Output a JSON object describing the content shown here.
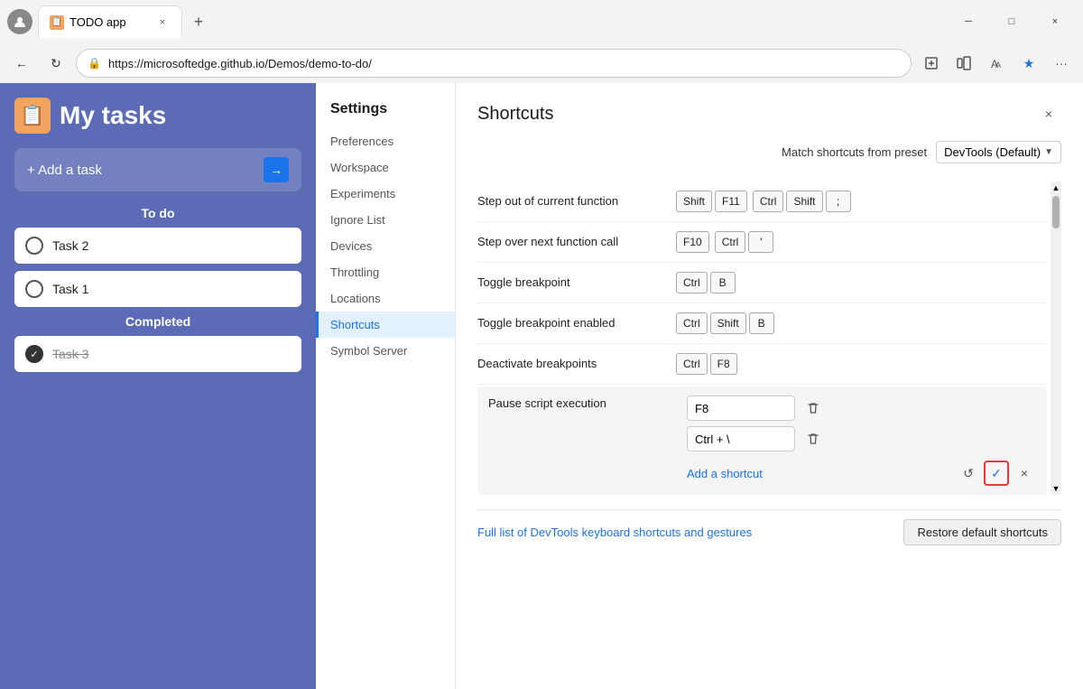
{
  "browser": {
    "tab_title": "TODO app",
    "url": "https://microsoftedge.github.io/Demos/demo-to-do/",
    "favicon": "📋",
    "nav": {
      "back": "←",
      "refresh": "↻",
      "forward": "→"
    },
    "window_controls": {
      "minimize": "─",
      "maximize": "□",
      "close": "×"
    }
  },
  "todo": {
    "title": "My tasks",
    "icon": "📋",
    "add_placeholder": "+ Add a task",
    "arrow": "→",
    "sections": {
      "todo_label": "To do",
      "completed_label": "Completed"
    },
    "tasks": [
      {
        "id": "task2",
        "text": "Task 2",
        "completed": false
      },
      {
        "id": "task1",
        "text": "Task 1",
        "completed": false
      }
    ],
    "completed_tasks": [
      {
        "id": "task3",
        "text": "Task 3",
        "completed": true
      }
    ]
  },
  "settings": {
    "title": "Settings",
    "nav_items": [
      {
        "id": "preferences",
        "label": "Preferences",
        "active": false
      },
      {
        "id": "workspace",
        "label": "Workspace",
        "active": false
      },
      {
        "id": "experiments",
        "label": "Experiments",
        "active": false
      },
      {
        "id": "ignore-list",
        "label": "Ignore List",
        "active": false
      },
      {
        "id": "devices",
        "label": "Devices",
        "active": false
      },
      {
        "id": "throttling",
        "label": "Throttling",
        "active": false
      },
      {
        "id": "locations",
        "label": "Locations",
        "active": false
      },
      {
        "id": "shortcuts",
        "label": "Shortcuts",
        "active": true
      },
      {
        "id": "symbol-server",
        "label": "Symbol Server",
        "active": false
      }
    ]
  },
  "shortcuts": {
    "title": "Shortcuts",
    "close_icon": "×",
    "preset_label": "Match shortcuts from preset",
    "preset_value": "DevTools (Default)",
    "preset_arrow": "▼",
    "items": [
      {
        "id": "step-out",
        "name": "Step out of current function",
        "key_groups": [
          [
            "Shift",
            "F11"
          ],
          [
            "Ctrl",
            "Shift",
            ";"
          ]
        ]
      },
      {
        "id": "step-over",
        "name": "Step over next function call",
        "key_groups": [
          [
            "F10"
          ],
          [
            "Ctrl",
            "'"
          ]
        ]
      },
      {
        "id": "toggle-bp",
        "name": "Toggle breakpoint",
        "key_groups": [
          [
            "Ctrl",
            "B"
          ]
        ]
      },
      {
        "id": "toggle-bp-enabled",
        "name": "Toggle breakpoint enabled",
        "key_groups": [
          [
            "Ctrl",
            "Shift",
            "B"
          ]
        ]
      },
      {
        "id": "deactivate-bp",
        "name": "Deactivate breakpoints",
        "key_groups": [
          [
            "Ctrl",
            "F8"
          ]
        ]
      }
    ],
    "editable_item": {
      "name": "Pause script execution",
      "inputs": [
        "F8",
        "Ctrl + \\"
      ],
      "add_shortcut_label": "Add a shortcut",
      "undo_icon": "↺",
      "confirm_icon": "✓",
      "cancel_icon": "×"
    },
    "bottom": {
      "link_text": "Full list of DevTools keyboard shortcuts and gestures",
      "restore_label": "Restore default shortcuts"
    }
  }
}
